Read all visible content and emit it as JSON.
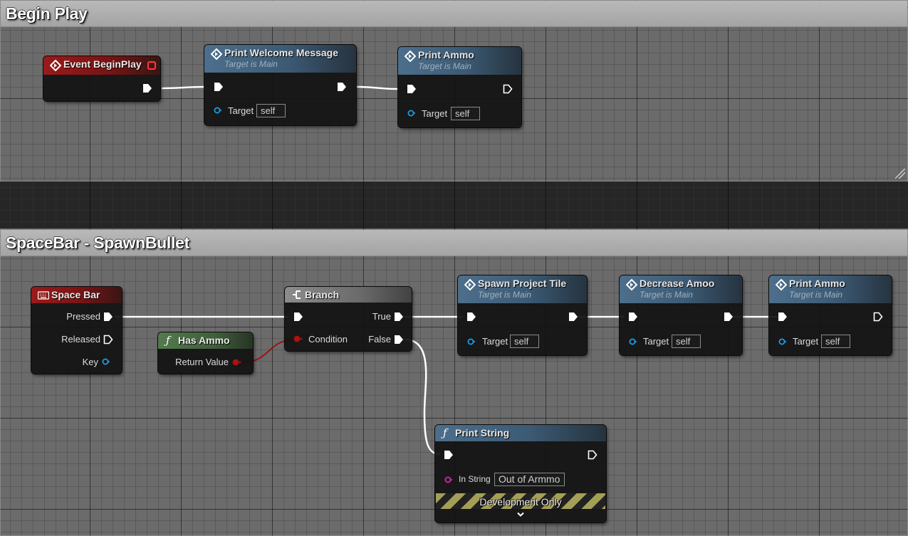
{
  "comments": [
    {
      "id": "begin-play",
      "title": "Begin Play"
    },
    {
      "id": "spacebar",
      "title": "SpaceBar - SpawnBullet"
    }
  ],
  "nodes": {
    "event_begin_play": {
      "title": "Event BeginPlay"
    },
    "print_welcome": {
      "title": "Print Welcome Message",
      "subtitle": "Target is Main",
      "target_label": "Target",
      "target_value": "self"
    },
    "print_ammo_1": {
      "title": "Print Ammo",
      "subtitle": "Target is Main",
      "target_label": "Target",
      "target_value": "self"
    },
    "space_bar": {
      "title": "Space Bar",
      "pins": {
        "pressed": "Pressed",
        "released": "Released",
        "key": "Key"
      }
    },
    "has_ammo": {
      "title": "Has Ammo",
      "return_label": "Return Value"
    },
    "branch": {
      "title": "Branch",
      "condition_label": "Condition",
      "true_label": "True",
      "false_label": "False"
    },
    "spawn_projectile": {
      "title": "Spawn Project Tile",
      "subtitle": "Target is Main",
      "target_label": "Target",
      "target_value": "self"
    },
    "decrease_ammo": {
      "title": "Decrease Amoo",
      "subtitle": "Target is Main",
      "target_label": "Target",
      "target_value": "self"
    },
    "print_ammo_2": {
      "title": "Print Ammo",
      "subtitle": "Target is Main",
      "target_label": "Target",
      "target_value": "self"
    },
    "print_string": {
      "title": "Print String",
      "in_string_label": "In String",
      "in_string_value": "Out of Armmo",
      "dev_label": "Development Only"
    }
  },
  "colors": {
    "event_header": "#9a1a1a",
    "function_header": "#4d6f8c",
    "pure_header": "#54794e",
    "branch_header": "#8c8c8c",
    "object_pin": "#1e9be0",
    "bool_pin": "#b01010",
    "string_pin": "#e020b0",
    "exec_wire": "#ffffff",
    "bool_wire": "#9a1414"
  },
  "icons": {
    "function_node": "diamond-arrow-icon",
    "pure_function": "function-f-icon",
    "keyboard": "keyboard-icon",
    "branch": "branch-icon",
    "delegate": "delegate-square-icon"
  }
}
